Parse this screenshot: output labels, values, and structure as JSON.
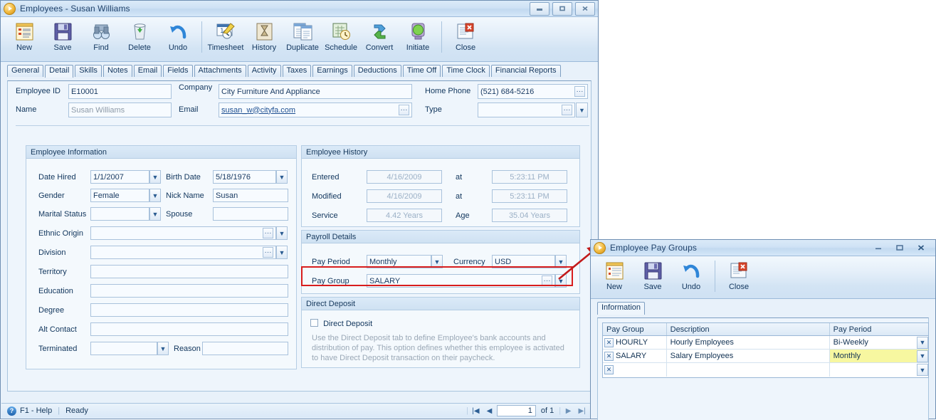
{
  "main_window": {
    "title": "Employees - Susan Williams",
    "controls": {
      "minimize": "—",
      "maximize": "❐",
      "close": "✕"
    },
    "toolbar": [
      {
        "label": "New",
        "icon": "new-record-icon"
      },
      {
        "label": "Save",
        "icon": "floppy-disk-icon"
      },
      {
        "label": "Find",
        "icon": "binoculars-icon"
      },
      {
        "label": "Delete",
        "icon": "recycle-bin-icon"
      },
      {
        "label": "Undo",
        "icon": "undo-arrow-icon"
      },
      {
        "label": "Timesheet",
        "icon": "timesheet-clock-icon"
      },
      {
        "label": "History",
        "icon": "hourglass-icon"
      },
      {
        "label": "Duplicate",
        "icon": "duplicate-pages-icon"
      },
      {
        "label": "Schedule",
        "icon": "schedule-clock-icon"
      },
      {
        "label": "Convert",
        "icon": "convert-arrows-icon"
      },
      {
        "label": "Initiate",
        "icon": "traffic-light-icon"
      },
      {
        "label": "Close",
        "icon": "close-document-icon"
      }
    ],
    "tabs": [
      "General",
      "Detail",
      "Skills",
      "Notes",
      "Email",
      "Fields",
      "Attachments",
      "Activity",
      "Taxes",
      "Earnings",
      "Deductions",
      "Time Off",
      "Time Clock",
      "Financial Reports"
    ],
    "active_tab": "Detail",
    "header_fields": {
      "employee_id_label": "Employee ID",
      "employee_id_value": "E10001",
      "name_label": "Name",
      "name_value": "Susan Williams",
      "company_label": "Company",
      "company_value": "City Furniture And Appliance",
      "email_label": "Email",
      "email_value": "susan_w@cityfa.com",
      "home_phone_label": "Home Phone",
      "home_phone_value": "(521) 684-5216",
      "type_label": "Type",
      "type_value": ""
    },
    "employee_information": {
      "title": "Employee Information",
      "rows": [
        {
          "label": "Date Hired",
          "value": "1/1/2007",
          "label2": "Birth Date",
          "value2": "5/18/1976"
        },
        {
          "label": "Gender",
          "value": "Female",
          "label2": "Nick Name",
          "value2": "Susan"
        },
        {
          "label": "Marital Status",
          "value": "",
          "label2": "Spouse",
          "value2": ""
        }
      ],
      "wide_rows": [
        {
          "label": "Ethnic Origin",
          "value": ""
        },
        {
          "label": "Division",
          "value": ""
        },
        {
          "label": "Territory",
          "value": ""
        },
        {
          "label": "Education",
          "value": ""
        },
        {
          "label": "Degree",
          "value": ""
        },
        {
          "label": "Alt Contact",
          "value": ""
        }
      ],
      "terminated_label": "Terminated",
      "terminated_value": "",
      "reason_label": "Reason",
      "reason_value": ""
    },
    "employee_history": {
      "title": "Employee History",
      "rows": [
        {
          "label": "Entered",
          "value": "4/16/2009",
          "mid": "at",
          "value2": "5:23:11 PM"
        },
        {
          "label": "Modified",
          "value": "4/16/2009",
          "mid": "at",
          "value2": "5:23:11 PM"
        },
        {
          "label": "Service",
          "value": "4.42 Years",
          "mid": "Age",
          "value2": "35.04 Years"
        }
      ]
    },
    "payroll_details": {
      "title": "Payroll Details",
      "pay_period_label": "Pay Period",
      "pay_period_value": "Monthly",
      "currency_label": "Currency",
      "currency_value": "USD",
      "pay_group_label": "Pay Group",
      "pay_group_value": "SALARY",
      "highlight_color": "#d81d1d"
    },
    "direct_deposit": {
      "title": "Direct Deposit",
      "checkbox_label": "Direct Deposit",
      "checked": false,
      "note": "Use the Direct Deposit tab to define Employee's bank accounts and distribution of pay. This option defines whether this employee is activated to have Direct Deposit transaction on their paycheck."
    },
    "status_bar": {
      "help": "F1 - Help",
      "status": "Ready",
      "page_value": "1",
      "page_of": "of 1",
      "first_icon": "first-record-icon",
      "prev_icon": "previous-record-icon",
      "next_icon": "next-record-icon",
      "last_icon": "last-record-icon"
    }
  },
  "pay_groups_window": {
    "title": "Employee Pay Groups",
    "controls": {
      "minimize": "−",
      "maximize": "❐",
      "close": "✕"
    },
    "toolbar": [
      {
        "label": "New",
        "icon": "new-record-icon"
      },
      {
        "label": "Save",
        "icon": "floppy-disk-icon"
      },
      {
        "label": "Undo",
        "icon": "undo-arrow-icon"
      },
      {
        "label": "Close",
        "icon": "close-document-icon"
      }
    ],
    "tabs": [
      "Information"
    ],
    "active_tab": "Information",
    "grid": {
      "columns": [
        "Pay Group",
        "Description",
        "Pay Period"
      ],
      "rows": [
        {
          "delete": "✕",
          "pay_group": "HOURLY",
          "description": "Hourly Employees",
          "pay_period": "Bi-Weekly",
          "highlight": false
        },
        {
          "delete": "✕",
          "pay_group": "SALARY",
          "description": "Salary Employees",
          "pay_period": "Monthly",
          "highlight": true
        },
        {
          "delete": "✕",
          "pay_group": "",
          "description": "",
          "pay_period": "",
          "highlight": false
        }
      ],
      "highlight_color": "#f7f7a0"
    }
  },
  "annotation": {
    "arrow_color": "#c21a1a",
    "arrow_name": "red-pointer-arrow"
  }
}
